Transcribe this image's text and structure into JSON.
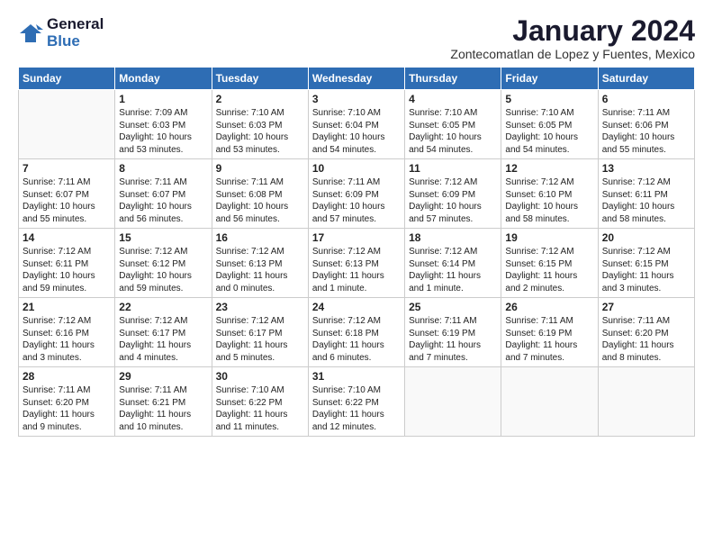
{
  "logo": {
    "line1": "General",
    "line2": "Blue"
  },
  "title": "January 2024",
  "subtitle": "Zontecomatlan de Lopez y Fuentes, Mexico",
  "weekdays": [
    "Sunday",
    "Monday",
    "Tuesday",
    "Wednesday",
    "Thursday",
    "Friday",
    "Saturday"
  ],
  "weeks": [
    [
      {
        "day": "",
        "info": ""
      },
      {
        "day": "1",
        "info": "Sunrise: 7:09 AM\nSunset: 6:03 PM\nDaylight: 10 hours\nand 53 minutes."
      },
      {
        "day": "2",
        "info": "Sunrise: 7:10 AM\nSunset: 6:03 PM\nDaylight: 10 hours\nand 53 minutes."
      },
      {
        "day": "3",
        "info": "Sunrise: 7:10 AM\nSunset: 6:04 PM\nDaylight: 10 hours\nand 54 minutes."
      },
      {
        "day": "4",
        "info": "Sunrise: 7:10 AM\nSunset: 6:05 PM\nDaylight: 10 hours\nand 54 minutes."
      },
      {
        "day": "5",
        "info": "Sunrise: 7:10 AM\nSunset: 6:05 PM\nDaylight: 10 hours\nand 54 minutes."
      },
      {
        "day": "6",
        "info": "Sunrise: 7:11 AM\nSunset: 6:06 PM\nDaylight: 10 hours\nand 55 minutes."
      }
    ],
    [
      {
        "day": "7",
        "info": "Sunrise: 7:11 AM\nSunset: 6:07 PM\nDaylight: 10 hours\nand 55 minutes."
      },
      {
        "day": "8",
        "info": "Sunrise: 7:11 AM\nSunset: 6:07 PM\nDaylight: 10 hours\nand 56 minutes."
      },
      {
        "day": "9",
        "info": "Sunrise: 7:11 AM\nSunset: 6:08 PM\nDaylight: 10 hours\nand 56 minutes."
      },
      {
        "day": "10",
        "info": "Sunrise: 7:11 AM\nSunset: 6:09 PM\nDaylight: 10 hours\nand 57 minutes."
      },
      {
        "day": "11",
        "info": "Sunrise: 7:12 AM\nSunset: 6:09 PM\nDaylight: 10 hours\nand 57 minutes."
      },
      {
        "day": "12",
        "info": "Sunrise: 7:12 AM\nSunset: 6:10 PM\nDaylight: 10 hours\nand 58 minutes."
      },
      {
        "day": "13",
        "info": "Sunrise: 7:12 AM\nSunset: 6:11 PM\nDaylight: 10 hours\nand 58 minutes."
      }
    ],
    [
      {
        "day": "14",
        "info": "Sunrise: 7:12 AM\nSunset: 6:11 PM\nDaylight: 10 hours\nand 59 minutes."
      },
      {
        "day": "15",
        "info": "Sunrise: 7:12 AM\nSunset: 6:12 PM\nDaylight: 10 hours\nand 59 minutes."
      },
      {
        "day": "16",
        "info": "Sunrise: 7:12 AM\nSunset: 6:13 PM\nDaylight: 11 hours\nand 0 minutes."
      },
      {
        "day": "17",
        "info": "Sunrise: 7:12 AM\nSunset: 6:13 PM\nDaylight: 11 hours\nand 1 minute."
      },
      {
        "day": "18",
        "info": "Sunrise: 7:12 AM\nSunset: 6:14 PM\nDaylight: 11 hours\nand 1 minute."
      },
      {
        "day": "19",
        "info": "Sunrise: 7:12 AM\nSunset: 6:15 PM\nDaylight: 11 hours\nand 2 minutes."
      },
      {
        "day": "20",
        "info": "Sunrise: 7:12 AM\nSunset: 6:15 PM\nDaylight: 11 hours\nand 3 minutes."
      }
    ],
    [
      {
        "day": "21",
        "info": "Sunrise: 7:12 AM\nSunset: 6:16 PM\nDaylight: 11 hours\nand 3 minutes."
      },
      {
        "day": "22",
        "info": "Sunrise: 7:12 AM\nSunset: 6:17 PM\nDaylight: 11 hours\nand 4 minutes."
      },
      {
        "day": "23",
        "info": "Sunrise: 7:12 AM\nSunset: 6:17 PM\nDaylight: 11 hours\nand 5 minutes."
      },
      {
        "day": "24",
        "info": "Sunrise: 7:12 AM\nSunset: 6:18 PM\nDaylight: 11 hours\nand 6 minutes."
      },
      {
        "day": "25",
        "info": "Sunrise: 7:11 AM\nSunset: 6:19 PM\nDaylight: 11 hours\nand 7 minutes."
      },
      {
        "day": "26",
        "info": "Sunrise: 7:11 AM\nSunset: 6:19 PM\nDaylight: 11 hours\nand 7 minutes."
      },
      {
        "day": "27",
        "info": "Sunrise: 7:11 AM\nSunset: 6:20 PM\nDaylight: 11 hours\nand 8 minutes."
      }
    ],
    [
      {
        "day": "28",
        "info": "Sunrise: 7:11 AM\nSunset: 6:20 PM\nDaylight: 11 hours\nand 9 minutes."
      },
      {
        "day": "29",
        "info": "Sunrise: 7:11 AM\nSunset: 6:21 PM\nDaylight: 11 hours\nand 10 minutes."
      },
      {
        "day": "30",
        "info": "Sunrise: 7:10 AM\nSunset: 6:22 PM\nDaylight: 11 hours\nand 11 minutes."
      },
      {
        "day": "31",
        "info": "Sunrise: 7:10 AM\nSunset: 6:22 PM\nDaylight: 11 hours\nand 12 minutes."
      },
      {
        "day": "",
        "info": ""
      },
      {
        "day": "",
        "info": ""
      },
      {
        "day": "",
        "info": ""
      }
    ]
  ]
}
